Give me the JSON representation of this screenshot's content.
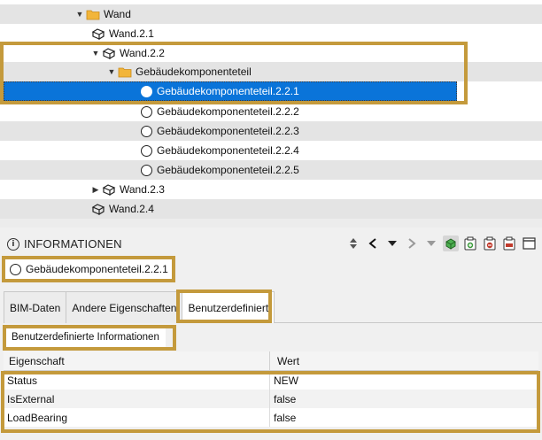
{
  "tree": {
    "rows": [
      {
        "label": "Wand",
        "icon": "folder-icon",
        "arrow": "▼",
        "expanded": true
      },
      {
        "label": "Wand.2.1",
        "icon": "wall-element-icon"
      },
      {
        "label": "Wand.2.2",
        "icon": "wall-element-icon",
        "arrow": "▼",
        "expanded": true
      },
      {
        "label": "Gebäudekomponenteteil",
        "icon": "folder-icon",
        "arrow": "▼",
        "expanded": true
      },
      {
        "label": "Gebäudekomponenteteil.2.2.1",
        "icon": "circle-element-icon",
        "selected": true
      },
      {
        "label": "Gebäudekomponenteteil.2.2.2",
        "icon": "circle-element-icon"
      },
      {
        "label": "Gebäudekomponenteteil.2.2.3",
        "icon": "circle-element-icon"
      },
      {
        "label": "Gebäudekomponenteteil.2.2.4",
        "icon": "circle-element-icon"
      },
      {
        "label": "Gebäudekomponenteteil.2.2.5",
        "icon": "circle-element-icon"
      },
      {
        "label": "Wand.2.3",
        "icon": "wall-element-icon",
        "arrow": "▶",
        "expanded": false
      },
      {
        "label": "Wand.2.4",
        "icon": "wall-element-icon"
      }
    ]
  },
  "info": {
    "title": "INFORMATIONEN",
    "selected_element": "Gebäudekomponenteteil.2.2.1",
    "toolbar_icons": [
      "sort-updown-icon",
      "prev-icon",
      "dropdown-icon",
      "next-icon",
      "dropdown-icon",
      "element-green-icon",
      "add-icon",
      "remove-icon",
      "delete-icon",
      "window-icon"
    ],
    "tabs": [
      {
        "label": "BIM-Daten",
        "active": false
      },
      {
        "label": "Andere Eigenschaften",
        "active": false
      },
      {
        "label": "Benutzerdefiniert",
        "active": true
      }
    ],
    "subtab": "Benutzerdefinierte Informationen",
    "table": {
      "columns": [
        "Eigenschaft",
        "Wert"
      ],
      "rows": [
        {
          "property": "Status",
          "value": "NEW"
        },
        {
          "property": "IsExternal",
          "value": "false"
        },
        {
          "property": "LoadBearing",
          "value": "false"
        }
      ]
    }
  },
  "colors": {
    "selection": "#0a74d9",
    "highlight_border": "#c49a3c",
    "folder": "#f2b53a",
    "add_green": "#3a9a3a",
    "remove_red": "#c0392b"
  }
}
